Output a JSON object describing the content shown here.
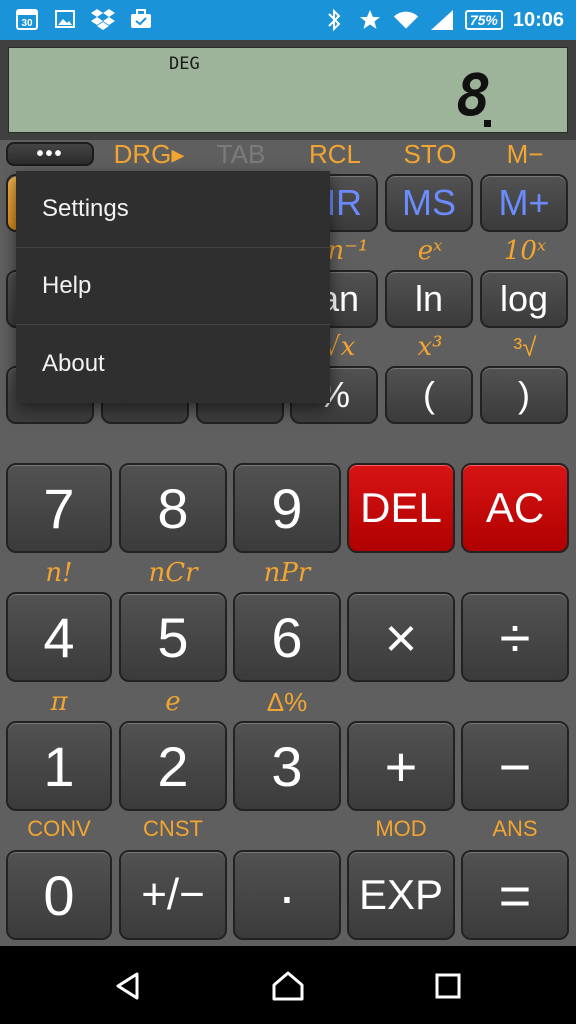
{
  "status_bar": {
    "left_icons": [
      "calendar-icon",
      "gallery-icon",
      "dropbox-icon",
      "briefcase-icon"
    ],
    "calendar_day": "30",
    "right_icons": [
      "bluetooth-icon",
      "star-icon",
      "wifi-icon",
      "signal-icon"
    ],
    "battery": "75%",
    "time": "10:06"
  },
  "display": {
    "angle_mode": "DEG",
    "value": "8"
  },
  "menu_button": "•••",
  "shift_row1": {
    "drg": "DRG▸",
    "tab": "TAB",
    "rcl": "RCL",
    "sto": "STO",
    "mminus": "M−"
  },
  "row1": {
    "mr": "MR",
    "ms": "MS",
    "mplus": "M+"
  },
  "shift_row2": {
    "atan": "tan⁻¹",
    "ex": "eˣ",
    "tenx": "10ˣ"
  },
  "row2": {
    "tan": "tan",
    "ln": "ln",
    "log": "log"
  },
  "shift_row3": {
    "xroot": "ˣ√x",
    "cube": "x³",
    "cuberoot": "³√"
  },
  "row3": {
    "percent": "%",
    "lparen": "(",
    "rparen": ")"
  },
  "numpad": {
    "seven": "7",
    "eight": "8",
    "nine": "9",
    "del": "DEL",
    "ac": "AC",
    "four": "4",
    "five": "5",
    "six": "6",
    "multiply": "×",
    "divide": "÷",
    "one": "1",
    "two": "2",
    "three": "3",
    "plus": "+",
    "minus": "−",
    "zero": "0",
    "negate": "+/−",
    "dot": "·",
    "exp": "EXP",
    "equals": "="
  },
  "shift_num": {
    "fact": "n!",
    "ncr": "nCr",
    "npr": "nPr",
    "pi": "π",
    "e": "e",
    "delta_pct": "Δ%",
    "conv": "CONV",
    "cnst": "CNST",
    "mod": "MOD",
    "ans": "ANS"
  },
  "popup_menu": {
    "items": [
      "Settings",
      "Help",
      "About"
    ]
  },
  "colors": {
    "status_bar": "#1b93d8",
    "lcd": "#9db49b",
    "shift_label": "#f2a531",
    "memory_label": "#6b8cff",
    "delete_key": "#c00000"
  }
}
